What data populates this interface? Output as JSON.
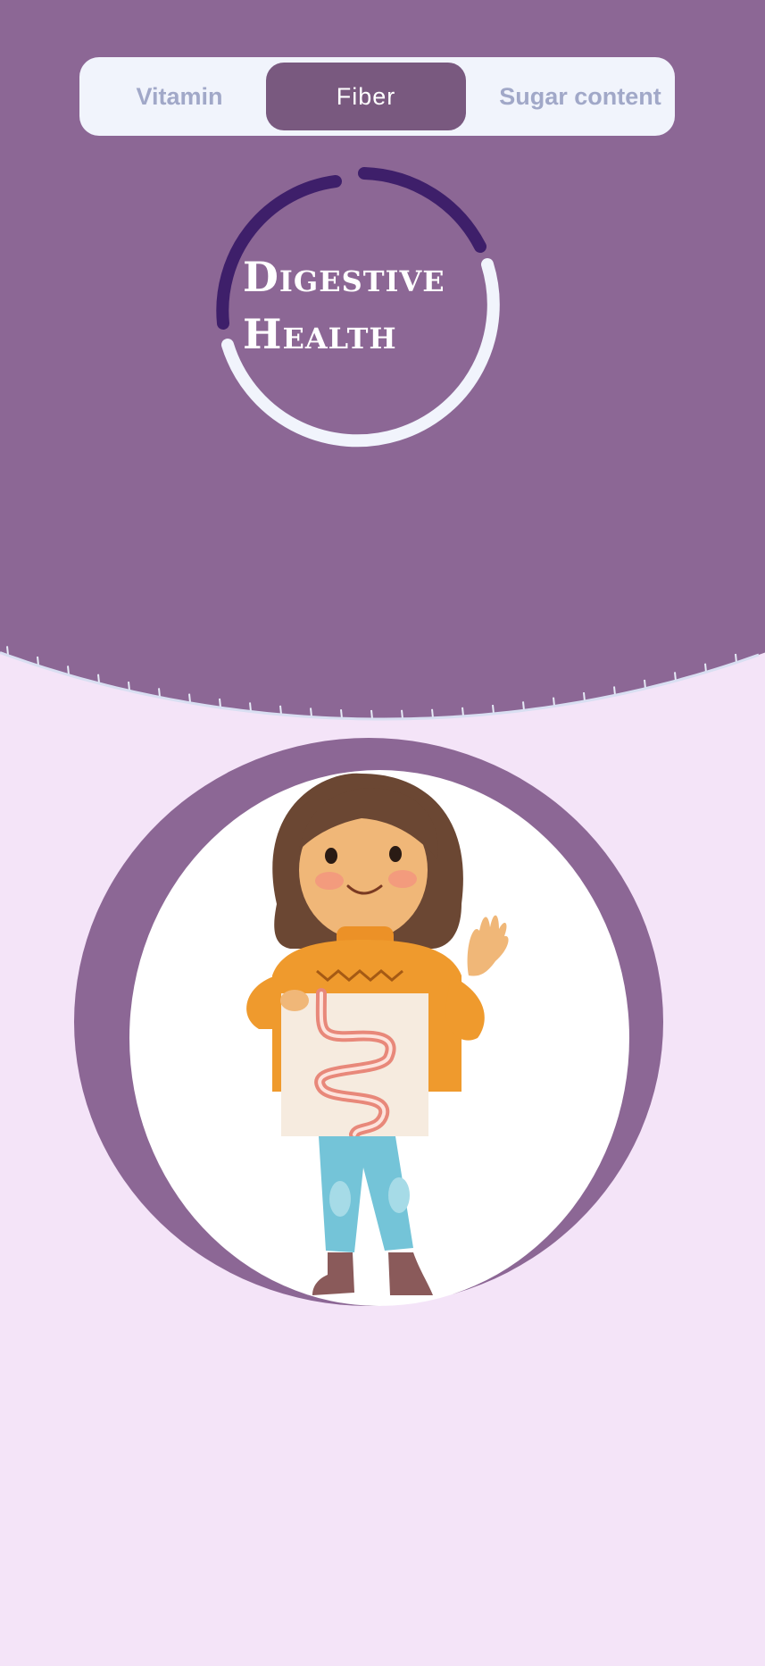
{
  "tabs": [
    {
      "label": "Vitamin",
      "active": false
    },
    {
      "label": "Fiber",
      "active": true
    },
    {
      "label": "Sugar content",
      "active": false
    }
  ],
  "hero": {
    "title_line1": "Digestive",
    "title_line2": "Health"
  },
  "progress_ring": {
    "progress": 0.35
  },
  "illustration": {
    "subject": "girl-holding-intestine-poster"
  },
  "colors": {
    "header_bg": "#8c6795",
    "page_bg": "#f4e4f8",
    "tab_bar_bg": "#f1f4fc",
    "tab_active_bg": "#79597f",
    "tab_inactive_text": "#a1a8c8",
    "ring_progress": "#3e1f6a",
    "ring_track": "#f1f4fc"
  }
}
